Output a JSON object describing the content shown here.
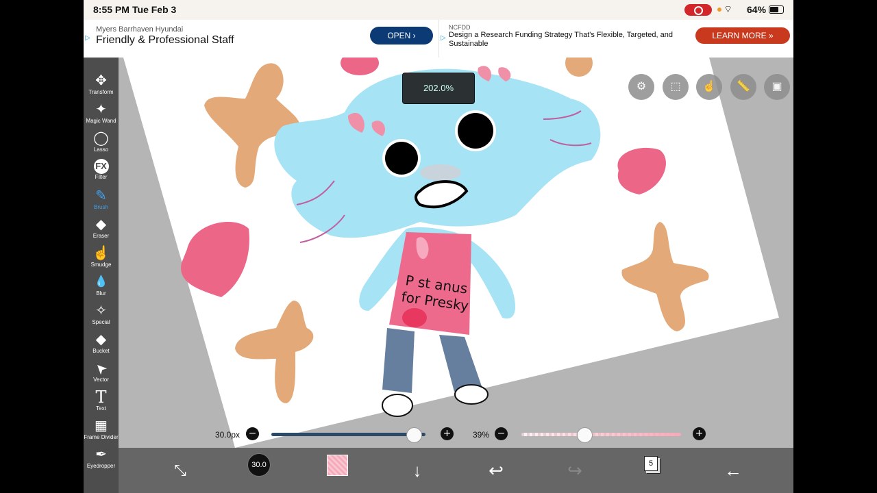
{
  "status_bar": {
    "time": "8:55 PM",
    "date": "Tue Feb 3",
    "battery": "64%"
  },
  "ads": [
    {
      "source": "Myers Barrhaven Hyundai",
      "title": "Friendly & Professional Staff",
      "cta": "OPEN ›"
    },
    {
      "source": "NCFDD",
      "title": "Design a Research Funding Strategy That's Flexible, Targeted, and Sustainable",
      "cta": "LEARN MORE »"
    }
  ],
  "tools": [
    {
      "label": "Transform",
      "icon": "✥"
    },
    {
      "label": "Magic Wand",
      "icon": "✦"
    },
    {
      "label": "Lasso",
      "icon": "◯"
    },
    {
      "label": "Filter",
      "icon": "FX"
    },
    {
      "label": "Brush",
      "icon": "✎"
    },
    {
      "label": "Eraser",
      "icon": "◆"
    },
    {
      "label": "Smudge",
      "icon": "☝"
    },
    {
      "label": "Blur",
      "icon": "💧"
    },
    {
      "label": "Special",
      "icon": "✧"
    },
    {
      "label": "Bucket",
      "icon": "◆"
    },
    {
      "label": "Vector",
      "icon": "➤"
    },
    {
      "label": "Text",
      "icon": "T"
    },
    {
      "label": "Frame Divider",
      "icon": "▦"
    },
    {
      "label": "Eyedropper",
      "icon": "✒"
    }
  ],
  "active_tool": "Brush",
  "canvas": {
    "zoom": "202.0%",
    "drawing_text_line1": "P st anus",
    "drawing_text_line2": "for Presky"
  },
  "sliders": {
    "brush_size": "30.0px",
    "brush_size_fraction": 0.92,
    "opacity": "39%",
    "opacity_fraction": 0.39
  },
  "bottom_bar": {
    "brush_size_value": "30.0",
    "layer_count": "5",
    "primary_color": "#f6a9b9"
  }
}
